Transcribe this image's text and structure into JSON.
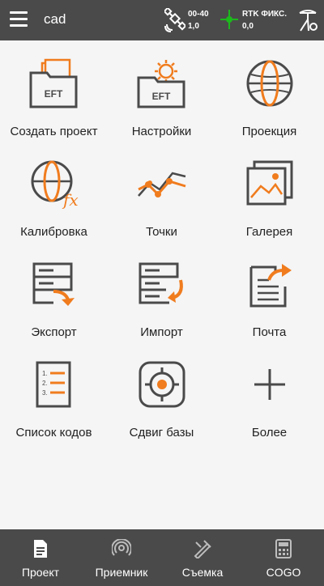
{
  "header": {
    "title": "cad",
    "sat_line1": "00-40",
    "sat_line2": "1,0",
    "rtk_line1": "RTK ФИКС.",
    "rtk_line2": "0,0"
  },
  "tiles": [
    {
      "label": "Создать проект",
      "icon": "create-project-icon"
    },
    {
      "label": "Настройки",
      "icon": "settings-folder-icon"
    },
    {
      "label": "Проекция",
      "icon": "projection-globe-icon"
    },
    {
      "label": "Калибровка",
      "icon": "calibration-icon"
    },
    {
      "label": "Точки",
      "icon": "points-icon"
    },
    {
      "label": "Галерея",
      "icon": "gallery-icon"
    },
    {
      "label": "Экспорт",
      "icon": "export-icon"
    },
    {
      "label": "Импорт",
      "icon": "import-icon"
    },
    {
      "label": "Почта",
      "icon": "mail-icon"
    },
    {
      "label": "Список кодов",
      "icon": "code-list-icon"
    },
    {
      "label": "Сдвиг базы",
      "icon": "base-shift-icon"
    },
    {
      "label": "Более",
      "icon": "plus-icon"
    }
  ],
  "nav": [
    {
      "label": "Проект",
      "icon": "project-doc-icon"
    },
    {
      "label": "Приемник",
      "icon": "receiver-icon"
    },
    {
      "label": "Съемка",
      "icon": "survey-icon"
    },
    {
      "label": "COGO",
      "icon": "calculator-icon"
    }
  ],
  "colors": {
    "accent": "#f07c1e",
    "bar": "#4a4a4a",
    "icon": "#4a4a4a",
    "rtk": "#1db81d"
  }
}
